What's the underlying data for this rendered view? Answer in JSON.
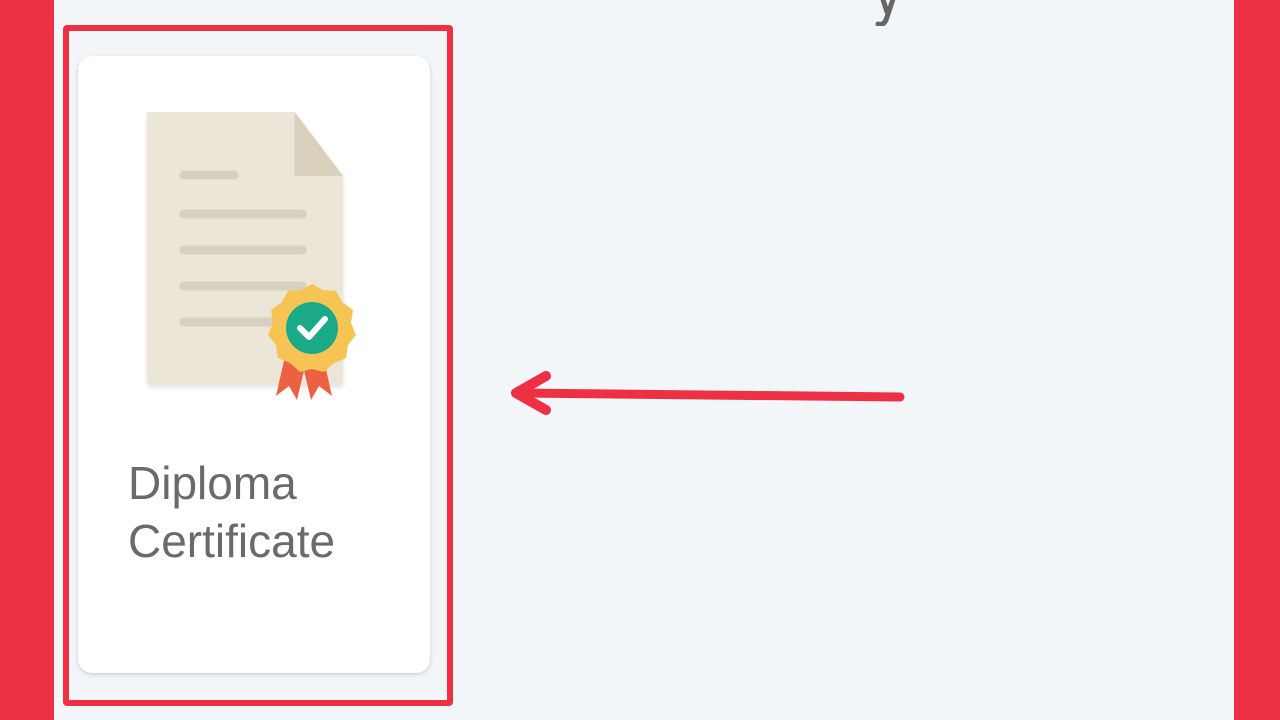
{
  "card": {
    "title_line1": "Diploma",
    "title_line2": "Certificate",
    "icon": "certificate-document-icon"
  },
  "annotation": {
    "highlight": "highlight-box",
    "pointer": "pointer-arrow"
  },
  "colors": {
    "frame": "#ee3045",
    "screen_bg": "#f3f6f8",
    "card_bg": "#ffffff",
    "paper": "#ece6d8",
    "paper_fold": "#d9d1bd",
    "paper_lines": "#d8d0bc",
    "badge_outer": "#f6c453",
    "badge_inner": "#1aaa8a",
    "ribbon": "#ee6044",
    "label_text": "#6a6a6a"
  }
}
